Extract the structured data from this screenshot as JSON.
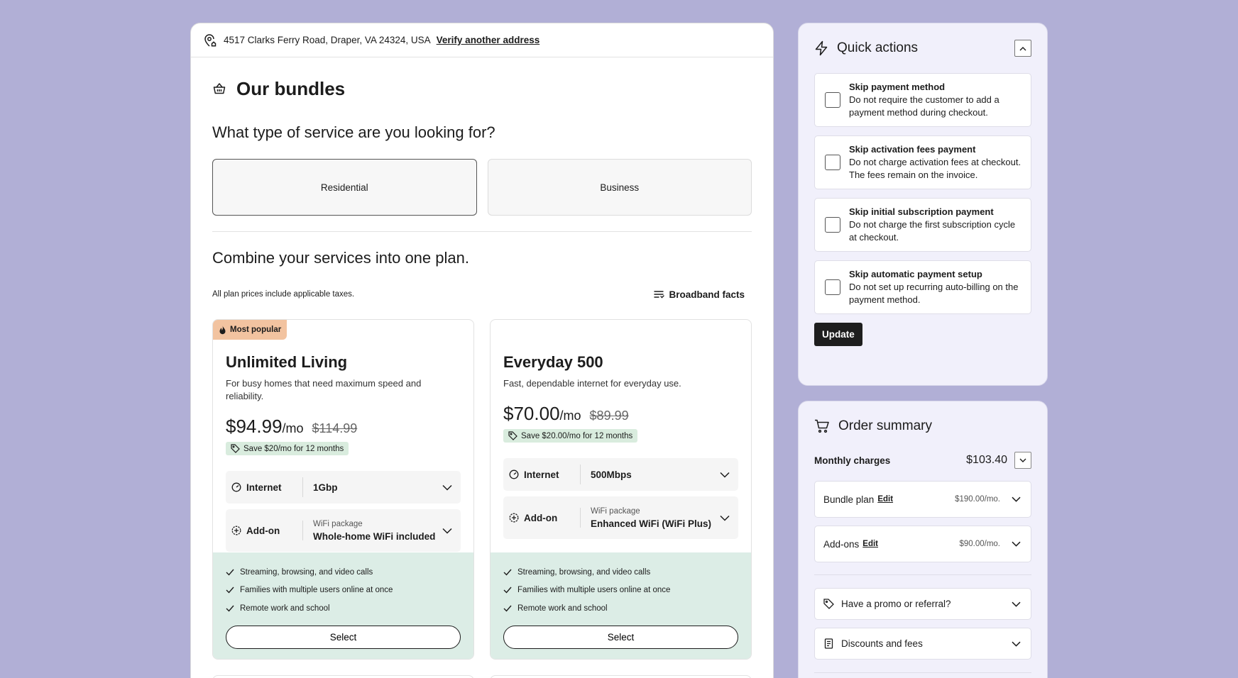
{
  "address": {
    "text": "4517 Clarks Ferry Road, Draper, VA 24324, USA",
    "verify_link": "Verify another address"
  },
  "main": {
    "title": "Our bundles",
    "service_question": "What type of service are you looking for?",
    "service_options": [
      {
        "label": "Residential",
        "selected": true
      },
      {
        "label": "Business",
        "selected": false
      }
    ],
    "combine_title": "Combine your services into one plan.",
    "taxes_note": "All plan prices include applicable taxes.",
    "broadband_link": "Broadband facts"
  },
  "plans": [
    {
      "badge": "Most popular",
      "name": "Unlimited Living",
      "description": "For busy homes that need maximum speed and reliability.",
      "price": "$94.99",
      "per": "/mo",
      "old_price": "$114.99",
      "save": "Save $20/mo for 12 months",
      "internet_label": "Internet",
      "internet_value": "1Gbp",
      "addon_label": "Add-on",
      "addon_sub": "WiFi package",
      "addon_value": "Whole-home WiFi included",
      "features": [
        "Streaming, browsing, and video calls",
        "Families with multiple users online at once",
        "Remote work and school"
      ],
      "select_label": "Select"
    },
    {
      "badge": "",
      "name": "Everyday 500",
      "description": "Fast, dependable internet for everyday use.",
      "price": "$70.00",
      "per": "/mo",
      "old_price": "$89.99",
      "save": "Save $20.00/mo for 12 months",
      "internet_label": "Internet",
      "internet_value": "500Mbps",
      "addon_label": "Add-on",
      "addon_sub": "WiFi package",
      "addon_value": "Enhanced WiFi (WiFi Plus)",
      "features": [
        "Streaming, browsing, and video calls",
        "Families with multiple users online at once",
        "Remote work and school"
      ],
      "select_label": "Select"
    }
  ],
  "quick_actions": {
    "title": "Quick actions",
    "items": [
      {
        "title": "Skip payment method",
        "desc": "Do not require the customer to add a payment method during checkout.",
        "checked": false
      },
      {
        "title": "Skip activation fees payment",
        "desc": "Do not charge activation fees at checkout. The fees remain on the invoice.",
        "checked": false
      },
      {
        "title": "Skip initial subscription payment",
        "desc": "Do not charge the first subscription cycle at checkout.",
        "checked": false
      },
      {
        "title": "Skip automatic payment setup",
        "desc": "Do not set up recurring auto-billing on the payment method.",
        "checked": false
      }
    ],
    "update_label": "Update"
  },
  "order_summary": {
    "title": "Order summary",
    "monthly_label": "Monthly charges",
    "monthly_amount": "$103.40",
    "rows": [
      {
        "label": "Bundle plan",
        "edit": "Edit",
        "cost": "$190.00/mo."
      },
      {
        "label": "Add-ons",
        "edit": "Edit",
        "cost": "$90.00/mo."
      }
    ],
    "promo_label": "Have a promo or referral?",
    "discounts_label": "Discounts and fees"
  }
}
